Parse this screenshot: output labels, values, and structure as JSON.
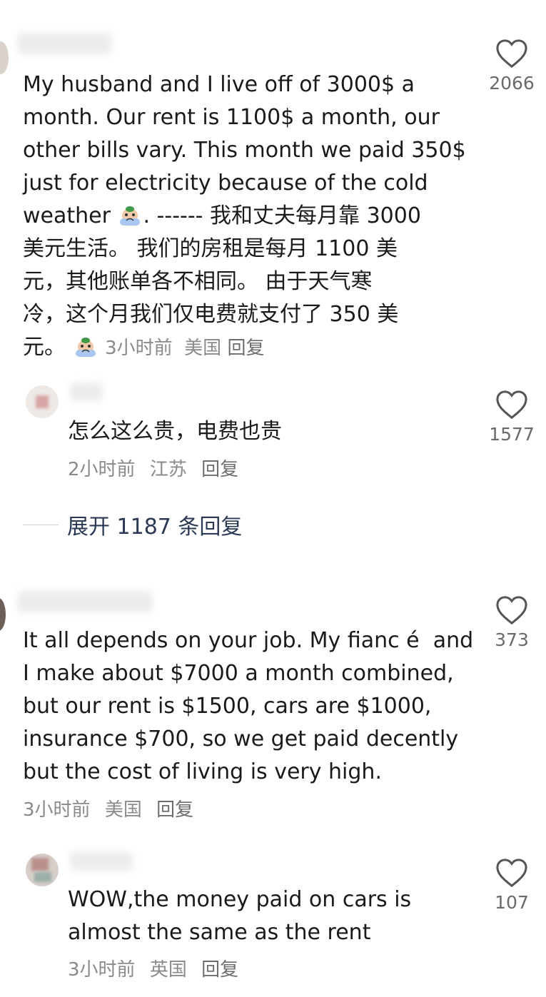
{
  "comments": [
    {
      "text_pre": "My husband and I live off of 3000$ a\nmonth. Our rent is 1100$ a month, our\nother bills vary. This month we paid 350$\njust for electricity because of the cold\nweather ",
      "text_mid": ". ------ 我和丈夫每月靠 3000\n美元生活。 我们的房租是每月 1100 美\n元，其他账单各不相同。 由于天气寒\n冷，这个月我们仅电费就支付了 350 美\n元。",
      "time": "3小时前",
      "location": "美国",
      "reply_label": "回复",
      "likes": "2066",
      "emoji": "crying-face"
    },
    {
      "text": "怎么这么贵，电费也贵",
      "time": "2小时前",
      "location": "江苏",
      "reply_label": "回复",
      "likes": "1577"
    },
    {
      "text": "It all depends on your job. My fianc é  and\nI make about $7000 a month combined,\nbut our rent is $1500, cars are $1000,\ninsurance $700, so we get paid decently\nbut the cost of living is very high.",
      "time": "3小时前",
      "location": "美国",
      "reply_label": "回复",
      "likes": "373"
    },
    {
      "text": "WOW,the money paid on cars is\nalmost the same as the rent",
      "time": "3小时前",
      "location": "英国",
      "reply_label": "回复",
      "likes": "107"
    }
  ],
  "expand_replies": "展开 1187 条回复",
  "colors": {
    "text": "#1a1a1a",
    "meta": "#8a8a8a",
    "expand": "#2a3a55",
    "like_icon": "#555555"
  }
}
